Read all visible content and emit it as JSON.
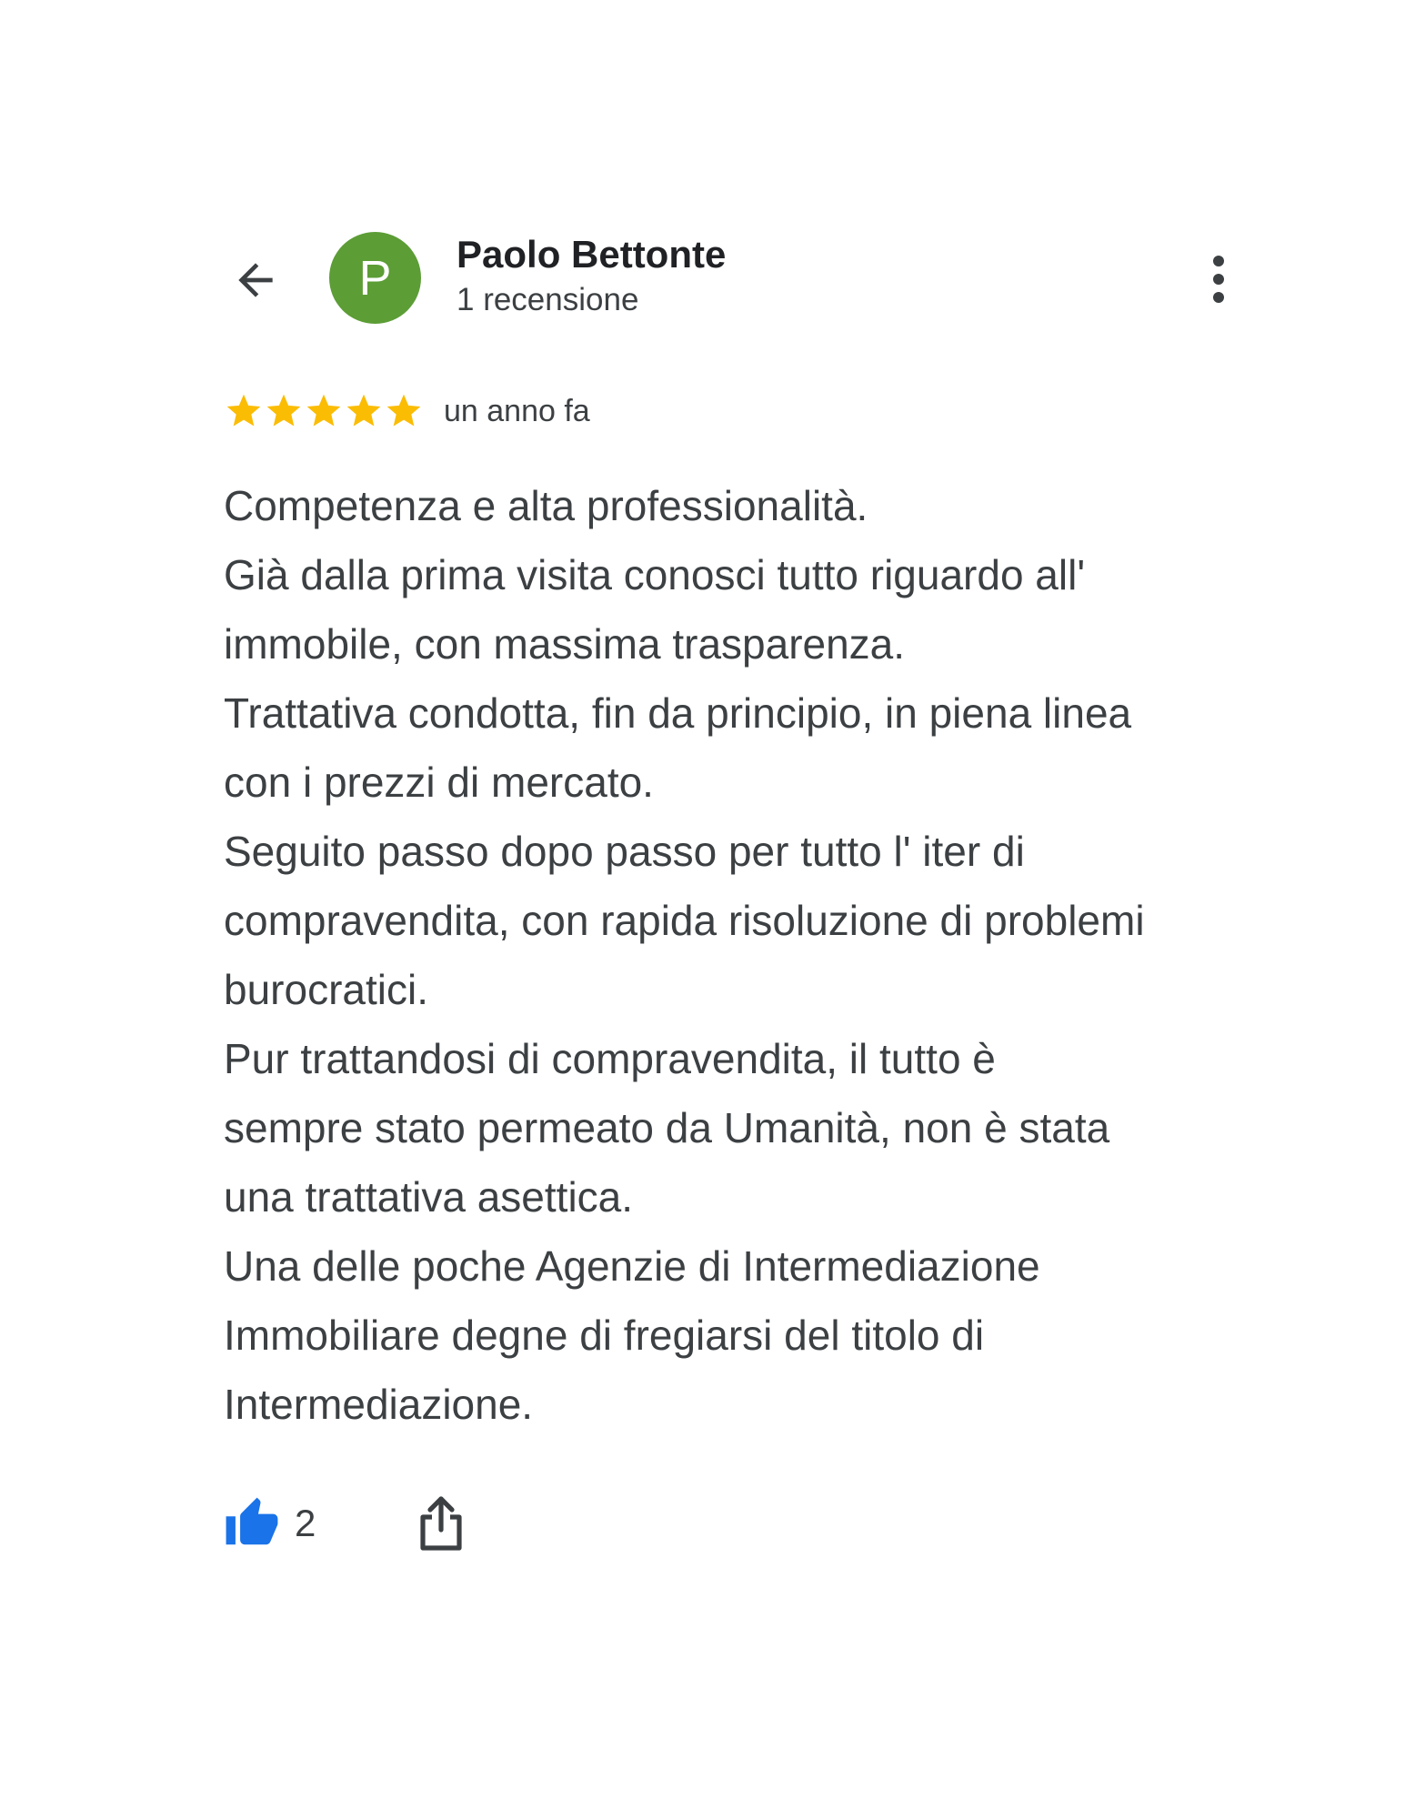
{
  "header": {
    "back_icon": "arrow-back-icon",
    "avatar_letter": "P",
    "avatar_color": "#5c9d36",
    "author_name": "Paolo Bettonte",
    "author_subtitle": "1 recensione",
    "more_icon": "more-vert-icon"
  },
  "review": {
    "rating": 5,
    "rating_max": 5,
    "star_color": "#fbbc04",
    "date": "un anno fa",
    "lines": [
      "Competenza e alta professionalità.",
      "Già dalla prima visita conosci tutto riguardo all'",
      "immobile, con massima trasparenza.",
      "Trattativa condotta, fin da principio, in piena linea",
      "con i prezzi di mercato.",
      "Seguito passo dopo passo per tutto l' iter di",
      "compravendita, con rapida risoluzione di problemi",
      "burocratici.",
      "Pur trattandosi di compravendita, il tutto è",
      "sempre stato permeato da Umanità, non è stata",
      "una trattativa asettica.",
      "Una delle poche Agenzie di Intermediazione",
      "Immobiliare degne di fregiarsi del titolo di",
      "Intermediazione."
    ]
  },
  "actions": {
    "like_icon": "thumb-up-icon",
    "like_color": "#1a73e8",
    "like_count": "2",
    "share_icon": "share-icon"
  }
}
